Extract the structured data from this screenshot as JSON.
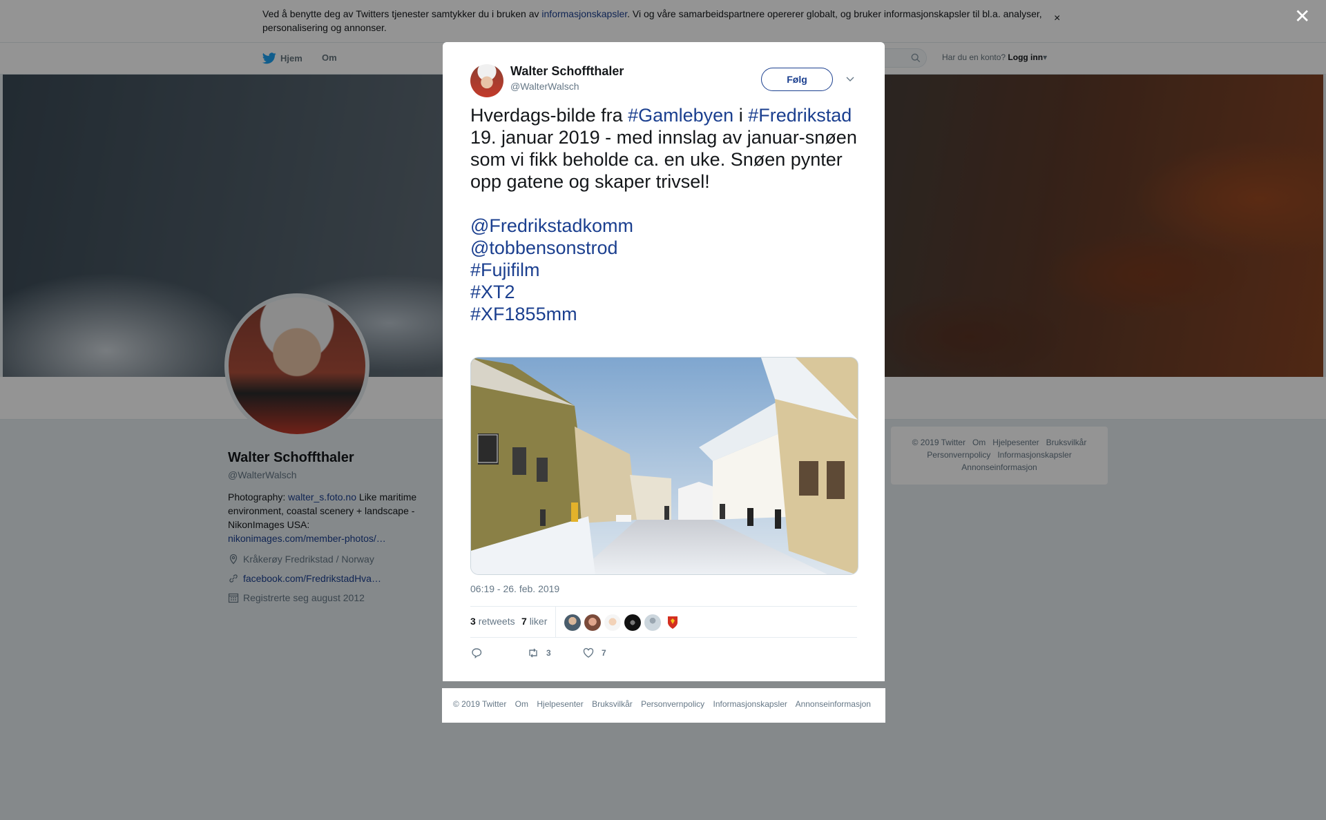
{
  "cookie": {
    "text_before": "Ved å benytte deg av Twitters tjenester samtykker du i bruken av ",
    "link": "informasjonskapsler",
    "text_after": ". Vi og våre samarbeidspartnere opererer globalt, og bruker informasjonskapsler til bl.a. analyser, personalisering og annonser.",
    "close": "×"
  },
  "nav": {
    "home": "Hjem",
    "about": "Om",
    "login_prompt": "Har du en konto?",
    "login": "Logg inn"
  },
  "profile": {
    "name": "Walter Schoffthaler",
    "handle": "@WalterWalsch",
    "bio_prefix": "Photography: ",
    "bio_link": "walter_s.foto.no",
    "bio_rest": " Like maritime environment, coastal scenery + landscape - NikonImages USA:",
    "bio_link2": "nikonimages.com/member-photos/…",
    "location": "Kråkerøy Fredrikstad / Norway",
    "website": "facebook.com/FredrikstadHva…",
    "joined": "Registrerte seg august 2012"
  },
  "right_footer": {
    "items": [
      "© 2019 Twitter",
      "Om",
      "Hjelpesenter",
      "Bruksvilkår",
      "Personvernpolicy",
      "Informasjonskapsler",
      "Annonseinformasjon"
    ]
  },
  "page_close": "✕",
  "tweet": {
    "author_name": "Walter Schoffthaler",
    "author_handle": "@WalterWalsch",
    "follow_label": "Følg",
    "text": {
      "p1": "Hverdags-bilde fra ",
      "tag1": "#Gamlebyen",
      "p2": " i ",
      "tag2": "#Fredrikstad",
      "p3": " 19. januar 2019 - med innslag av januar-snøen som vi fikk beholde ca. en uke. Snøen pynter opp gatene og skaper trivsel!",
      "mention1": "@Fredrikstadkomm",
      "mention2": "@tobbensonstrod",
      "tag3": "#Fujifilm",
      "tag4": "#XT2",
      "tag5": "#XF1855mm"
    },
    "timestamp": "06:19 - 26. feb. 2019",
    "retweets_count": "3",
    "retweets_label": "retweets",
    "likes_count": "7",
    "likes_label": "liker",
    "actions": {
      "reply_count": "",
      "retweet_count": "3",
      "like_count": "7"
    }
  },
  "modal_footer": {
    "items": [
      "© 2019 Twitter",
      "Om",
      "Hjelpesenter",
      "Bruksvilkår",
      "Personvernpolicy",
      "Informasjonskapsler",
      "Annonseinformasjon"
    ]
  },
  "colors": {
    "link": "#1b3f8f",
    "muted": "#657786",
    "overlay": "rgba(0,0,0,0.42)"
  }
}
